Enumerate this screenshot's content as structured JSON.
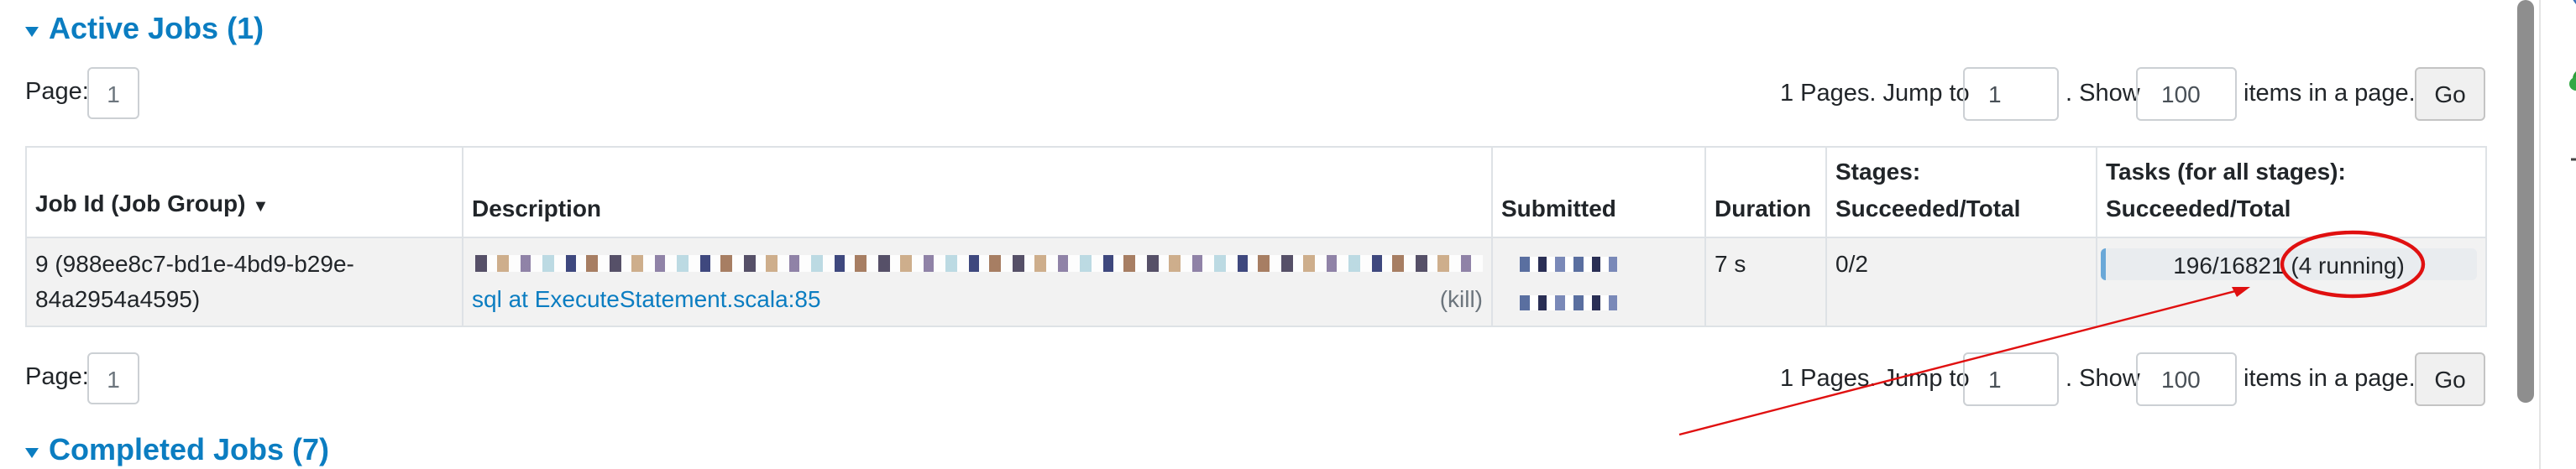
{
  "active_jobs": {
    "title": "Active Jobs (1)",
    "page_label": "Page:",
    "page_value": "1",
    "pagination": {
      "pages_text": "1 Pages. Jump to",
      "jump_value": "1",
      "show_label": ". Show",
      "show_value": "100",
      "items_label": "items in a page.",
      "go_label": "Go"
    },
    "table": {
      "headers": {
        "job_id": "Job Id (Job Group)",
        "sort_indicator": "▼",
        "description": "Description",
        "submitted": "Submitted",
        "duration": "Duration",
        "stages_line1": "Stages:",
        "stages_line2": "Succeeded/Total",
        "tasks_line1": "Tasks (for all stages):",
        "tasks_line2": "Succeeded/Total"
      },
      "rows": [
        {
          "job_id_line1": "9 (988ee8c7-bd1e-4bd9-b29e-",
          "job_id_line2": "84a2954a4595)",
          "description_link": "sql at ExecuteStatement.scala:85",
          "kill_label": "(kill)",
          "duration": "7 s",
          "stages": "0/2",
          "tasks_text": "196/16821",
          "tasks_running": "(4 running)",
          "tasks_progress": 0.0117
        }
      ]
    }
  },
  "bottom_pagination": {
    "page_label": "Page:",
    "page_value": "1",
    "pages_text": "1 Pages. Jump to",
    "jump_value": "1",
    "show_label": ". Show",
    "show_value": "100",
    "items_label": "items in a page.",
    "go_label": "Go"
  },
  "completed_jobs": {
    "title": "Completed Jobs (7)"
  },
  "sidebar_icons": [
    "filter-icon",
    "tree-icon",
    "plus-icon"
  ],
  "colors": {
    "accent": "#0b7dc1",
    "annotation": "#e01010"
  }
}
